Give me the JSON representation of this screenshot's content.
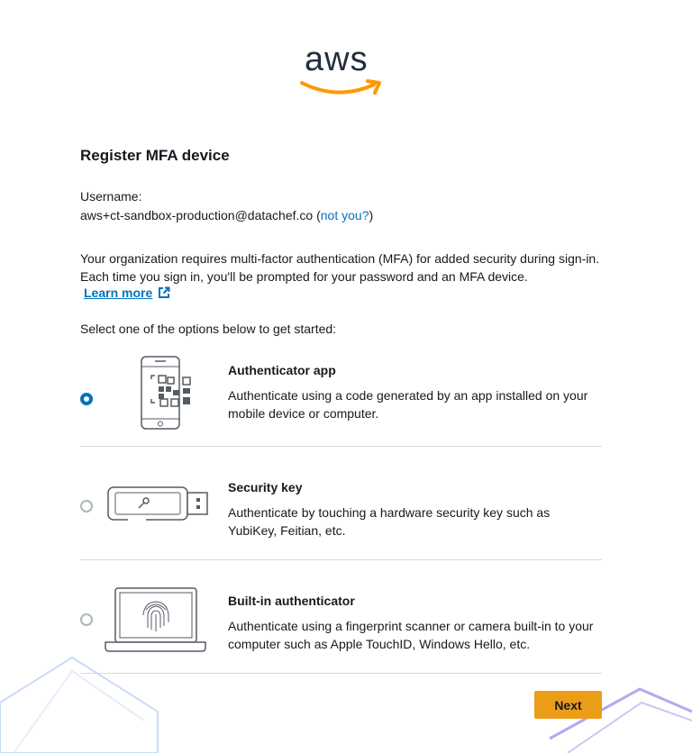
{
  "brand": {
    "logo_text": "aws"
  },
  "page": {
    "title": "Register MFA device"
  },
  "user": {
    "label": "Username:",
    "username": "aws+ct-sandbox-production@datachef.co",
    "open_paren": " (",
    "not_you_link": "not you?",
    "close_paren": ")"
  },
  "info": {
    "description": "Your organization requires multi-factor authentication (MFA) for added security during sign-in. Each time you sign in, you'll be prompted for your password and an MFA device.",
    "learn_more": "Learn more"
  },
  "options_intro": "Select one of the options below to get started:",
  "options": [
    {
      "title": "Authenticator app",
      "description": "Authenticate using a code generated by an app installed on your mobile device or computer.",
      "selected": true,
      "icon": "phone-qr-icon"
    },
    {
      "title": "Security key",
      "description": "Authenticate by touching a hardware security key such as YubiKey, Feitian, etc.",
      "selected": false,
      "icon": "usb-key-icon"
    },
    {
      "title": "Built-in authenticator",
      "description": "Authenticate using a fingerprint scanner or camera built-in to your computer such as Apple TouchID, Windows Hello, etc.",
      "selected": false,
      "icon": "laptop-fingerprint-icon"
    }
  ],
  "actions": {
    "next_label": "Next"
  },
  "colors": {
    "accent": "#ec9d18",
    "link": "#0073bb",
    "text": "#16191f",
    "logo_smile": "#ff9900"
  }
}
